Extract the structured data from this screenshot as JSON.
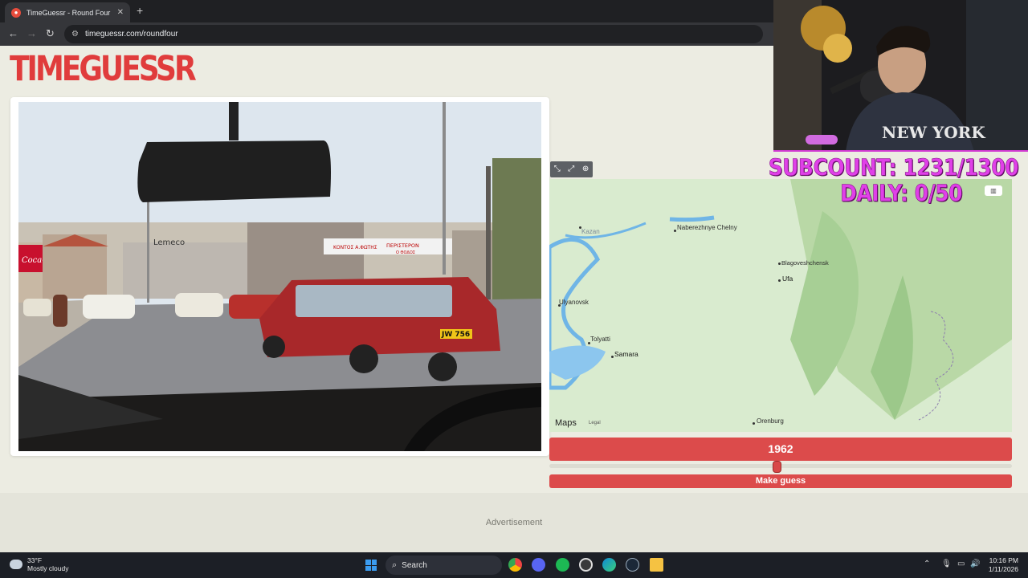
{
  "browser": {
    "tab_title": "TimeGuessr - Round Four",
    "tab_close": "✕",
    "new_tab": "+",
    "back": "←",
    "forward": "→",
    "reload": "↻",
    "url": "timeguessr.com/roundfour"
  },
  "page": {
    "logo": "TIMEGUESSR",
    "photo_signs": {
      "shop_sign": "Lemeco",
      "banner_left": "ΚΟΝΤΟΣ Α.ΦΩΤΗΣ",
      "banner_right": "ΠΕΡΙΣΤΕΡΟΝ",
      "banner_sub": "Ο ΘΟΔΟΣ",
      "cola_sign": "Coca-Cola",
      "plate": "JW 756"
    },
    "map": {
      "controls": [
        "⤡",
        "⤢",
        "⊕"
      ],
      "layer_button": "▥",
      "brand": " Maps",
      "legal": "Legal",
      "labels": {
        "kazan": "Kazan",
        "naberezhnye": "Naberezhnye Chelny",
        "blagoveshchensk": "Blagoveshchensk",
        "ufa": "Ufa",
        "ulyanovsk": "Ulyanovsk",
        "tolyatti": "Tolyatti",
        "samara": "Samara",
        "orenburg": "Orenburg"
      }
    },
    "year": "1962",
    "slider": {
      "min": 1900,
      "max": 2026,
      "value": 1962
    },
    "guess_button": "Make guess",
    "ad_label": "Advertisement"
  },
  "overlay": {
    "subcount": "SUBCOUNT: 1231/1300",
    "daily": "DAILY: 0/50",
    "sweatshirt_text": "NEW YORK"
  },
  "taskbar": {
    "temperature": "33°F",
    "condition": "Mostly cloudy",
    "search_label": "Search",
    "search_icon": "⌕",
    "time": "10:16 PM",
    "date": "1/11/2026",
    "tray_chevron": "⌃"
  },
  "colors": {
    "accent_red": "#dc4b4b",
    "overlay_magenta": "#e040e8",
    "page_bg": "#ecece2"
  }
}
